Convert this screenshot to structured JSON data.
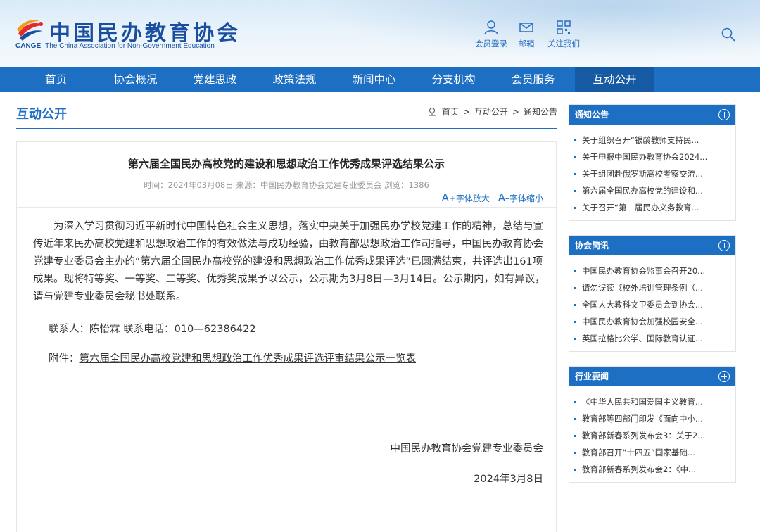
{
  "header": {
    "logo_cn": "中国民办教育协会",
    "logo_abbr": "CANGE",
    "logo_en": "The China Association for Non-Government Education",
    "links": [
      {
        "label": "会员登录",
        "icon": "user-icon"
      },
      {
        "label": "邮箱",
        "icon": "mail-icon"
      },
      {
        "label": "关注我们",
        "icon": "qrcode-icon"
      }
    ]
  },
  "nav": {
    "items": [
      "首页",
      "协会概况",
      "党建思政",
      "政策法规",
      "新闻中心",
      "分支机构",
      "会员服务",
      "互动公开"
    ],
    "active": "互动公开"
  },
  "page": {
    "section_title": "互动公开",
    "breadcrumb": [
      "首页",
      "互动公开",
      "通知公告"
    ]
  },
  "article": {
    "title": "第六届全国民办高校党的建设和思想政治工作优秀成果评选结果公示",
    "meta": "时间：2024年03月08日 来源：中国民办教育协会党建专业委员会 浏览：1386",
    "font_larger": "+字体放大",
    "font_smaller": "–字体缩小",
    "body": "为深入学习贯彻习近平新时代中国特色社会主义思想，落实中央关于加强民办学校党建工作的精神，总结与宣传近年来民办高校党建和思想政治工作的有效做法与成功经验，由教育部思想政治工作司指导，中国民办教育协会党建专业委员会主办的“第六届全国民办高校党的建设和思想政治工作优秀成果评选”已圆满结束，共评选出161项成果。现将特等奖、一等奖、二等奖、优秀奖成果予以公示，公示期为3月8日—3月14日。公示期内，如有异议，请与党建专业委员会秘书处联系。",
    "contact": "联系人：陈怡霖  联系电话：010—62386422",
    "attachment_label": "附件：",
    "attachment_link": "第六届全国民办高校党建和思想政治工作优秀成果评选评审结果公示一览表",
    "sign_org": "中国民办教育协会党建专业委员会",
    "sign_date": "2024年3月8日"
  },
  "sidebar": {
    "panels": [
      {
        "title": "通知公告",
        "items": [
          "关于组织召开“银龄教师支持民...",
          "关于申报中国民办教育协会2024...",
          "关于组团赴俄罗斯高校考察交流...",
          "第六届全国民办高校党的建设和...",
          "关于召开“第二届民办义务教育..."
        ]
      },
      {
        "title": "协会简讯",
        "items": [
          "中国民办教育协会监事会召开20...",
          "请勿误读《校外培训管理条例（...",
          "全国人大教科文卫委员会到协会...",
          "中国民办教育协会加强校园安全...",
          "英国拉格比公学、国际教育认证..."
        ]
      },
      {
        "title": "行业要闻",
        "items": [
          "《中华人民共和国爱国主义教育...",
          "教育部等四部门印发《面向中小...",
          "教育部新春系列发布会3：关于2...",
          "教育部召开“十四五”国家基础...",
          "教育部新春系列发布会2：《中..."
        ]
      }
    ]
  },
  "colors": {
    "primary": "#1d6fc4",
    "nav_active": "#155aa3"
  }
}
